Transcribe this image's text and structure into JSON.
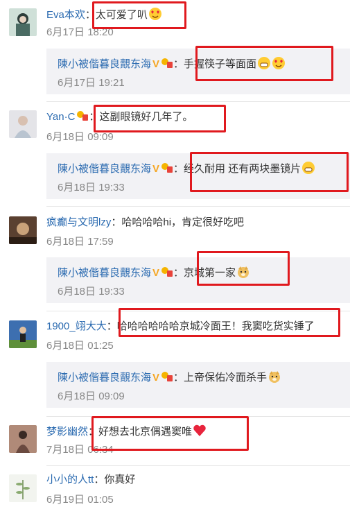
{
  "comments": [
    {
      "user": "Eva本欢",
      "text": "太可爱了叭",
      "time": "6月17日 18:20",
      "reply": {
        "user": "陳小被偕暮良覿东海",
        "text": "手握筷子等面面",
        "time": "6月17日 19:21"
      }
    },
    {
      "user": "Yan·C",
      "text": "这副眼镜好几年了。",
      "time": "6月18日 09:09",
      "reply": {
        "user": "陳小被偕暮良覿东海",
        "text": "经久耐用 还有两块墨镜片",
        "time": "6月18日 19:33"
      }
    },
    {
      "user": "疯癫与文明lzy",
      "text": "哈哈哈哈hi，肯定很好吃吧",
      "time": "6月18日 17:59",
      "reply": {
        "user": "陳小被偕暮良覿东海",
        "text": "京城第一家",
        "time": "6月18日 19:33"
      }
    },
    {
      "user": "1900_翊大大",
      "text": "哈哈哈哈哈哈京城冷面王！我窦吃货实锤了",
      "time": "6月18日 01:25",
      "reply": {
        "user": "陳小被偕暮良覿东海",
        "text": "上帝保佑冷面杀手",
        "time": "6月18日 09:09"
      }
    },
    {
      "user": "梦影幽然",
      "text": "好想去北京偶遇窦唯",
      "time": "7月18日 06:34"
    },
    {
      "user": "小小的人tt",
      "text": "你真好",
      "time": "6月19日 01:05"
    }
  ],
  "verified_badge": "V",
  "colors": {
    "username": "#2a6ab0",
    "highlight": "#e0191e",
    "reply_bg": "#f2f2f5",
    "time": "#888888"
  }
}
